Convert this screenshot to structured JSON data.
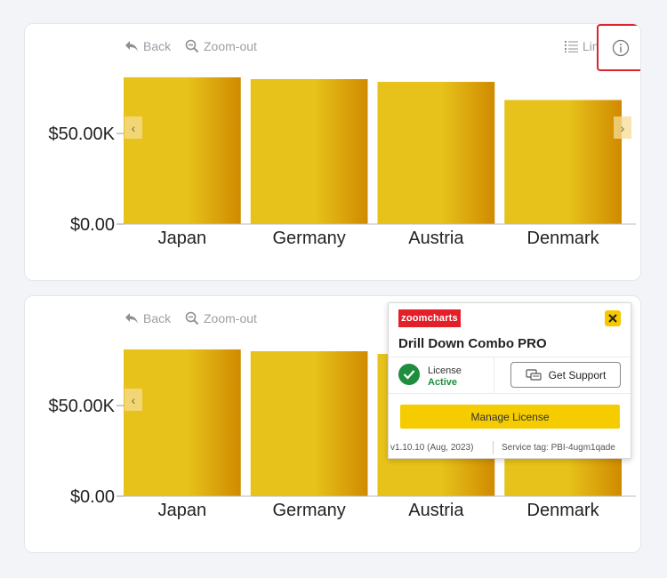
{
  "toolbar": {
    "back_label": "Back",
    "zoom_out_label": "Zoom-out",
    "list_label": "Lin"
  },
  "chart_data": [
    {
      "type": "bar",
      "categories": [
        "Japan",
        "Germany",
        "Austria",
        "Denmark"
      ],
      "values": [
        81000,
        80000,
        78500,
        68500
      ],
      "ylim": [
        0,
        80000
      ],
      "yticks": [
        {
          "value": 0,
          "label": "$0.00"
        },
        {
          "value": 50000,
          "label": "$50.00K"
        }
      ],
      "grid": false,
      "bar_colors": [
        "#e6c21a",
        "#d08a00"
      ]
    },
    {
      "type": "bar",
      "categories": [
        "Japan",
        "Germany",
        "Austria",
        "Denmark"
      ],
      "values": [
        81000,
        80000,
        78500,
        68500
      ],
      "ylim": [
        0,
        80000
      ],
      "yticks": [
        {
          "value": 0,
          "label": "$0.00"
        },
        {
          "value": 50000,
          "label": "$50.00K"
        }
      ],
      "grid": false,
      "bar_colors": [
        "#e6c21a",
        "#d08a00"
      ]
    }
  ],
  "popup": {
    "logo_text": "zoomcharts",
    "title": "Drill Down Combo PRO",
    "license_label": "License",
    "license_status": "Active",
    "support_label": "Get Support",
    "manage_label": "Manage License",
    "version": "v1.10.10 (Aug, 2023)",
    "service_tag": "Service tag: PBI-4ugm1qade"
  },
  "colors": {
    "accent": "#f5cc00",
    "brand_red": "#e3202a",
    "success": "#1e8e3e",
    "highlight_border": "#d9232e"
  },
  "icons": {
    "back": "back-arrow-icon",
    "zoom_out": "zoom-out-icon",
    "list": "list-icon",
    "info": "info-icon",
    "close": "close-icon",
    "check": "check-icon",
    "support": "chat-icon"
  }
}
